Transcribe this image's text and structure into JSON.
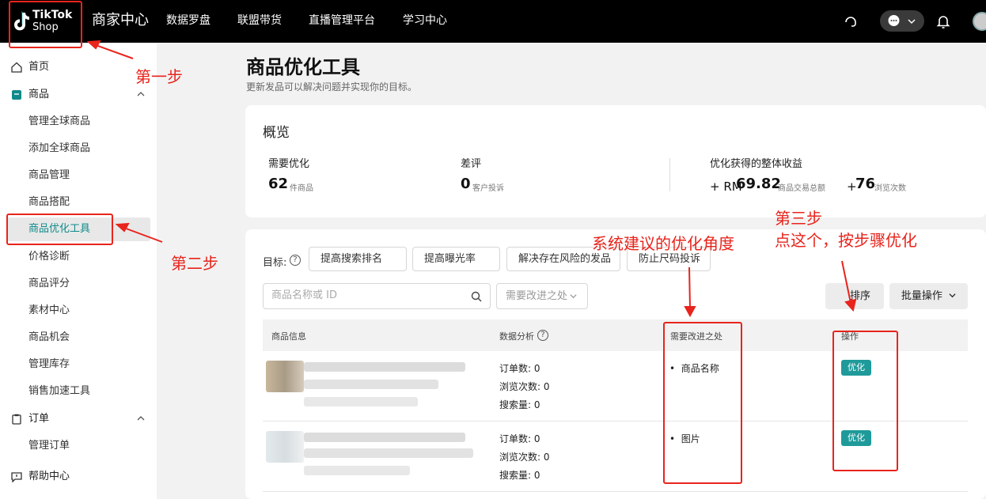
{
  "topbar": {
    "logo_line1": "TikTok",
    "logo_line2": "Shop",
    "app_title": "商家中心",
    "nav": [
      "数据罗盘",
      "联盟带货",
      "直播管理平台",
      "学习中心"
    ]
  },
  "sidebar": {
    "home": "首页",
    "products": "商品",
    "product_items": [
      "管理全球商品",
      "添加全球商品",
      "商品管理",
      "商品搭配",
      "商品优化工具",
      "价格诊断",
      "商品评分",
      "素材中心",
      "商品机会",
      "管理库存",
      "销售加速工具"
    ],
    "orders": "订单",
    "order_items": [
      "管理订单"
    ],
    "help": "帮助中心"
  },
  "page": {
    "title": "商品优化工具",
    "subtitle": "更新发品可以解决问题并实现你的目标。"
  },
  "overview": {
    "title": "概览",
    "need_opt_label": "需要优化",
    "need_opt_value": "62",
    "need_opt_unit": "件商品",
    "bad_review_label": "差评",
    "bad_review_value": "0",
    "bad_review_unit": "客户投诉",
    "gain_label": "优化获得的整体收益",
    "gain_rm_prefix": "+ RM",
    "gain_rm_value": "69.82",
    "gain_rm_unit": "商品交易总额",
    "gain_views_prefix": "+",
    "gain_views_value": "76",
    "gain_views_unit": "浏览次数"
  },
  "filters": {
    "goal_label": "目标:",
    "chips": [
      "提高搜索排名",
      "提高曝光率",
      "解决存在风险的发品",
      "防止尺码投诉"
    ],
    "search_placeholder": "商品名称或 ID",
    "select_placeholder": "需要改进之处",
    "sort_label": "排序",
    "bulk_label": "批量操作"
  },
  "table": {
    "headers": [
      "商品信息",
      "数据分析",
      "需要改进之处",
      "操作"
    ],
    "rows": [
      {
        "orders": "订单数: 0",
        "views": "浏览次数: 0",
        "searches": "搜索量: 0",
        "improve": "商品名称",
        "action": "优化"
      },
      {
        "orders": "订单数: 0",
        "views": "浏览次数: 0",
        "searches": "搜索量: 0",
        "improve": "图片",
        "action": "优化"
      }
    ]
  },
  "annotations": {
    "step1": "第一步",
    "step2": "第二步",
    "suggest": "系统建议的优化角度",
    "step3_line1": "第三步",
    "step3_line2": "点这个，按步骤优化"
  },
  "colors": {
    "accent": "#1f9a9a",
    "annotation": "#e8241c",
    "topbar": "#000000"
  }
}
